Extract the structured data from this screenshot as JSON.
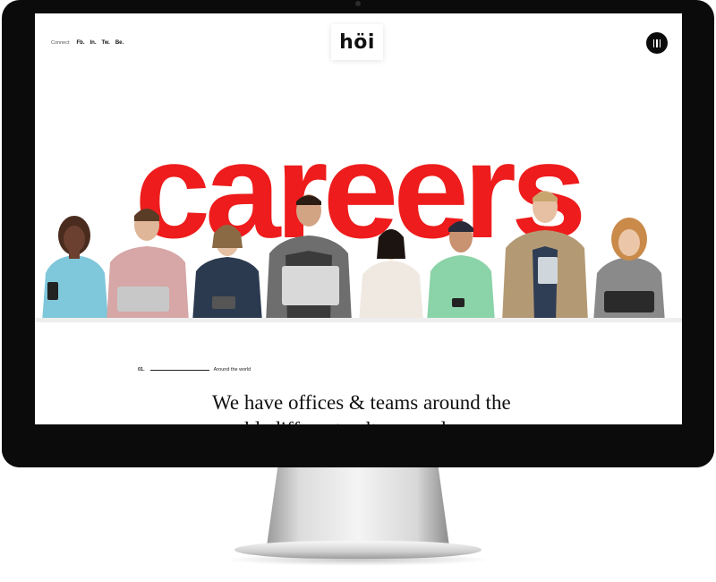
{
  "site": {
    "logo": "höi"
  },
  "nav": {
    "connect_label": "Connect",
    "social_links": [
      "Fb.",
      "In.",
      "Tw.",
      "Be."
    ]
  },
  "hero": {
    "word": "careers",
    "accent_color": "#ee1c1c"
  },
  "section": {
    "number": "01.",
    "label": "Around the world",
    "headline_line1": "We have offices & teams around the",
    "headline_line2": "world, different cultures and"
  },
  "icons": {
    "menu": "menu-icon"
  },
  "colors": {
    "bezel": "#0b0b0b",
    "accent": "#ee1c1c",
    "text": "#111111"
  }
}
